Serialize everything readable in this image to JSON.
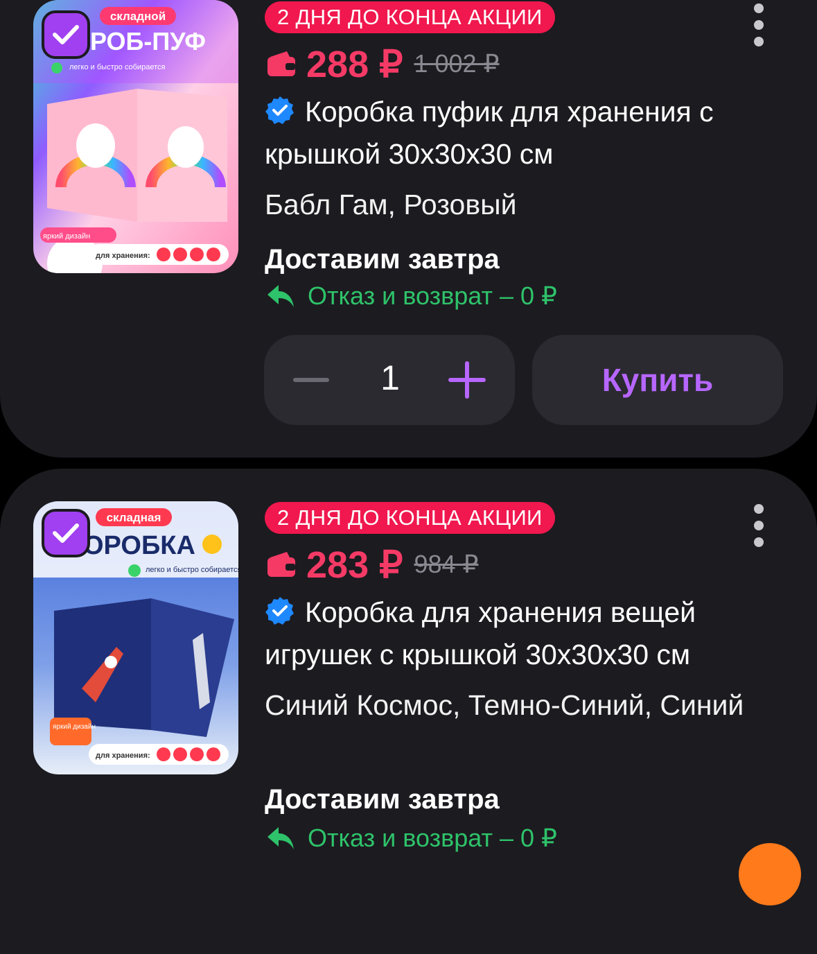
{
  "colors": {
    "card_bg": "#1c1b20",
    "promo_badge": "#f0184e",
    "price": "#f53a66",
    "accent_purple": "#b766ff",
    "return_green": "#2ec36a",
    "verified_blue": "#1e88ff"
  },
  "products": [
    {
      "selected": true,
      "image_banner": "складной",
      "image_title": "РОБ-ПУФ",
      "image_note": "легко и быстро собирается",
      "image_badge": "яркий дизайн",
      "image_footer": "для хранения:",
      "promo": "2 ДНЯ ДО КОНЦА АКЦИИ",
      "price": "288 ₽",
      "old_price": "1 002 ₽",
      "title": "Коробка пуфик для хранения с крышкой 30х30х30 см",
      "variant": "Бабл Гам, Розовый",
      "delivery": "Доставим завтра",
      "returns": "Отказ и возврат – 0 ₽",
      "quantity": "1",
      "buy_label": "Купить"
    },
    {
      "selected": true,
      "image_banner": "складная",
      "image_title": "ОРОБКА",
      "image_note": "легко и быстро собирается",
      "image_badge": "яркий дизайн",
      "image_footer": "для хранения:",
      "promo": "2 ДНЯ ДО КОНЦА АКЦИИ",
      "price": "283 ₽",
      "old_price": "984 ₽",
      "title": "Коробка для хранения вещей игрушек с крышкой 30х30х30 см",
      "variant": "Синий Космос, Темно-Синий, Синий",
      "delivery": "Доставим завтра",
      "returns": "Отказ и возврат – 0 ₽"
    }
  ],
  "icons": {
    "check": "checkmark-icon",
    "wallet": "wallet-icon",
    "verified": "verified-badge-icon",
    "return": "return-arrow-icon",
    "menu": "more-vertical-icon",
    "minus": "minus-icon",
    "plus": "plus-icon"
  }
}
